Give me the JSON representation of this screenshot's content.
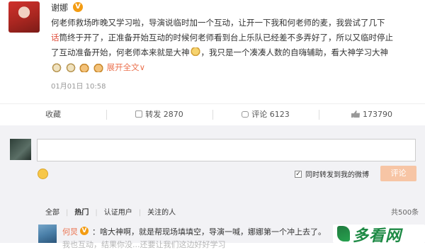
{
  "post": {
    "author": "谢娜",
    "verified_badge": "V",
    "line1": "何老师救场昨晚又学习啦，导演说临时加一个互动，让开一下我和何老师的麦，我尝试了几下",
    "line2_highlight": "话",
    "line2_rest": "筒终于开了，正准备开始互动的时候何老师看到台上乐队已经差不多弄好了，所以又临时停止",
    "line3_a": "了互动准备开始，何老师本来就是大神",
    "line3_b": "，我只是一个凑凑人数的自嗨辅助，看大神学习大神",
    "expand_label": "展开全文∨",
    "time": "01月01日 10:58",
    "emoji_icons": [
      "gold-crown-icon",
      "king-icon",
      "victory-hand-icon",
      "victory-hand-icon"
    ]
  },
  "actions": {
    "favorite": "收藏",
    "repost": "转发 2870",
    "comment": "评论 6123",
    "like": "173790"
  },
  "compose": {
    "placeholder": "",
    "also_repost_label": "同时转发到我的微博",
    "also_repost_checked": "✓",
    "submit": "评论"
  },
  "filter": {
    "all": "全部",
    "hot": "热门",
    "verified": "认证用户",
    "following": "关注的人",
    "total": "共500条"
  },
  "comment": {
    "name": "何炅",
    "badge": "V",
    "text": "：啥大神啊，就是帮现场填填空，导演一喊，娜娜第一个冲上去了。",
    "text2": "我也互动，结果你没...还要让我们这边好好学习"
  },
  "watermark": {
    "text": "多看网"
  }
}
